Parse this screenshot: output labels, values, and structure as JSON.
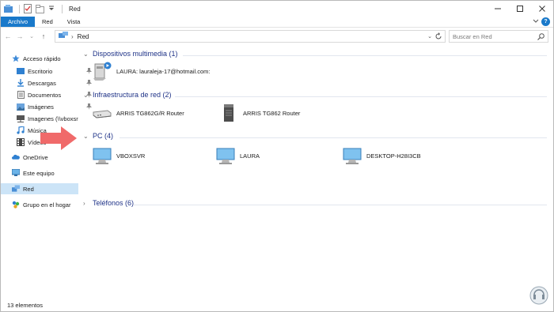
{
  "window": {
    "title": "Red"
  },
  "ribbon": {
    "tabs": [
      {
        "label": "Archivo"
      },
      {
        "label": "Red"
      },
      {
        "label": "Vista"
      }
    ]
  },
  "address": {
    "path": "Red"
  },
  "search": {
    "placeholder": "Buscar en Red"
  },
  "sidebar": {
    "items": [
      {
        "label": "Acceso rápido"
      },
      {
        "label": "Escritorio"
      },
      {
        "label": "Descargas"
      },
      {
        "label": "Documentos"
      },
      {
        "label": "Imágenes"
      },
      {
        "label": "Imagenes (\\\\vboxsr"
      },
      {
        "label": "Música"
      },
      {
        "label": "Vídeos"
      },
      {
        "label": "OneDrive"
      },
      {
        "label": "Este equipo"
      },
      {
        "label": "Red"
      },
      {
        "label": "Grupo en el hogar"
      }
    ]
  },
  "groups": {
    "multimedia": {
      "header": "Dispositivos multimedia (1)",
      "devices": [
        {
          "label": "LAURA: lauraleja-17@hotmail.com:"
        }
      ]
    },
    "infra": {
      "header": "Infraestructura de red (2)",
      "devices": [
        {
          "label": "ARRIS TG862G/R Router"
        },
        {
          "label": "ARRIS TG862 Router"
        }
      ]
    },
    "pc": {
      "header": "PC (4)",
      "devices": [
        {
          "label": "VBOXSVR"
        },
        {
          "label": "LAURA"
        },
        {
          "label": "DESKTOP-H28I3CB"
        }
      ]
    },
    "phones": {
      "header": "Teléfonos (6)"
    }
  },
  "status": {
    "items_count": "13 elementos"
  },
  "colors": {
    "accent": "#1979ca",
    "group_header": "#1e3287",
    "selection": "#cce4f7",
    "arrow": "#f06a6a"
  }
}
